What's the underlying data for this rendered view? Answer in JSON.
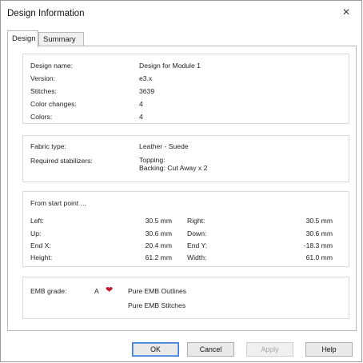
{
  "window": {
    "title": "Design Information",
    "close_glyph": "×"
  },
  "tabs": [
    {
      "label": "Design",
      "active": true
    },
    {
      "label": "Summary",
      "active": false
    }
  ],
  "design": {
    "name_label": "Design name:",
    "name_value": "Design for Module 1",
    "version_label": "Version:",
    "version_value": "e3.x",
    "stitches_label": "Stitches:",
    "stitches_value": "3639",
    "color_changes_label": "Color changes:",
    "color_changes_value": "4",
    "colors_label": "Colors:",
    "colors_value": "4"
  },
  "fabric": {
    "fabric_type_label": "Fabric type:",
    "fabric_type_value": "Leather - Suede",
    "stabilizers_label": "Required stabilizers:",
    "topping": "Topping:",
    "backing": "Backing: Cut Away x 2"
  },
  "measurements": {
    "heading": "From start point ...",
    "left_label": "Left:",
    "left_value": "30.5 mm",
    "right_label": "Right:",
    "right_value": "30.5 mm",
    "up_label": "Up:",
    "up_value": "30.6 mm",
    "down_label": "Down:",
    "down_value": "30.6 mm",
    "endx_label": "End X:",
    "endx_value": "20.4 mm",
    "endy_label": "End Y:",
    "endy_value": "-18.3 mm",
    "height_label": "Height:",
    "height_value": "61.2 mm",
    "width_label": "Width:",
    "width_value": "61.0 mm"
  },
  "grade": {
    "label": "EMB grade:",
    "value": "A",
    "icon": "heart-icon",
    "icon_color": "#c4182c",
    "outlines": "Pure EMB Outlines",
    "stitches": "Pure EMB Stitches"
  },
  "buttons": {
    "ok": "OK",
    "cancel": "Cancel",
    "apply": "Apply",
    "help": "Help"
  },
  "colors": {
    "default_button_border": "#3d7bd6",
    "disabled_text": "#a8a8a8"
  }
}
